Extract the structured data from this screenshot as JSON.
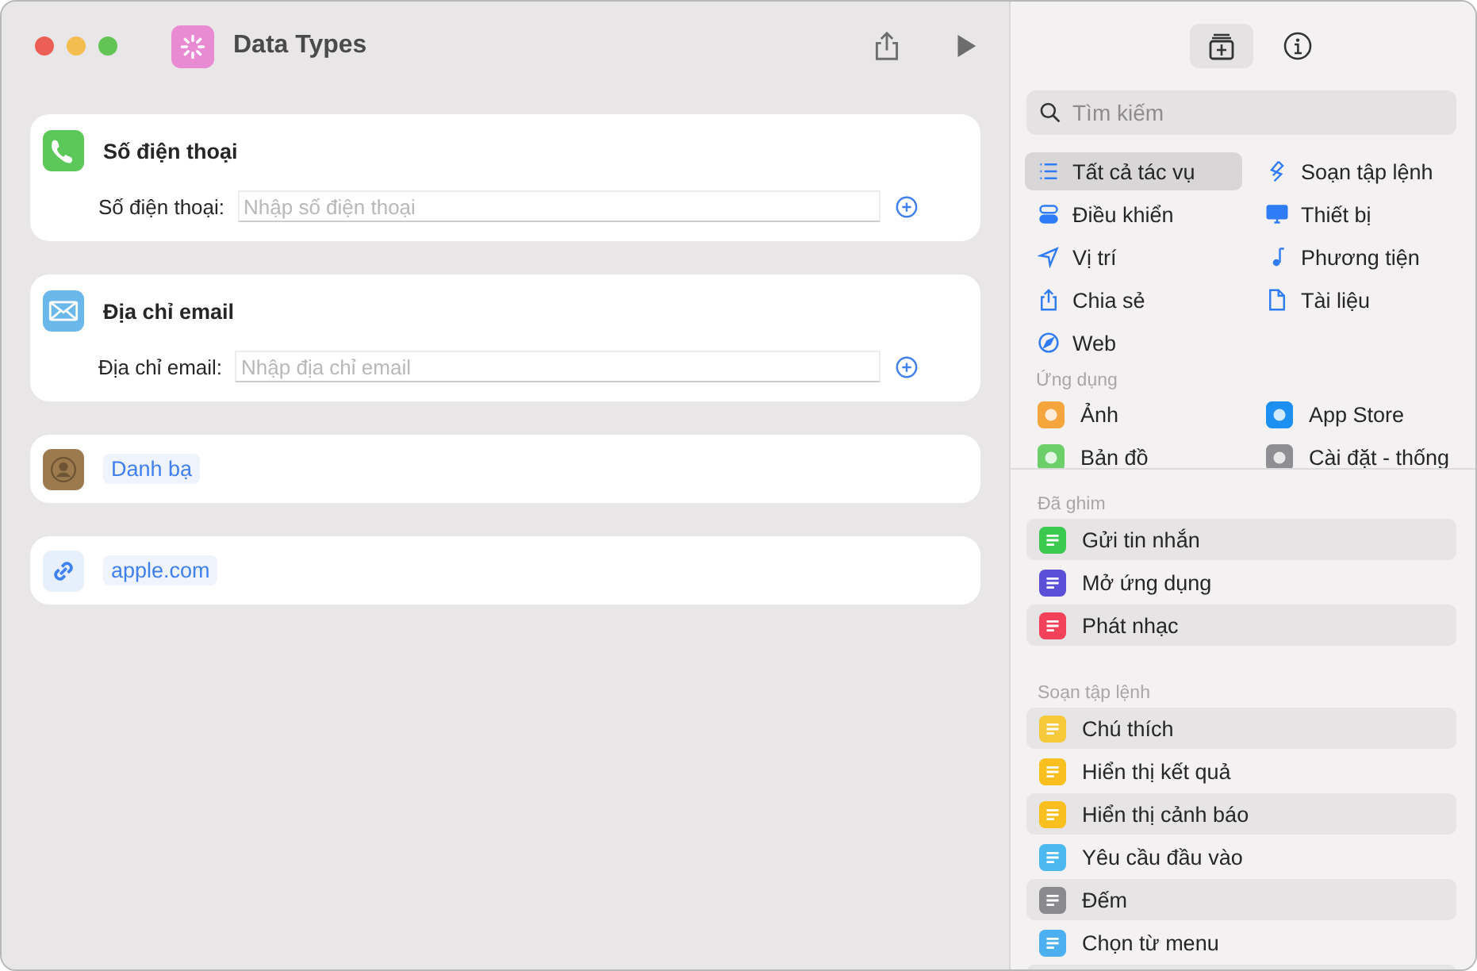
{
  "window": {
    "title": "Data Types"
  },
  "cards": [
    {
      "kind": "field",
      "title": "Số điện thoại",
      "label": "Số điện thoại:",
      "placeholder": "Nhập số điện thoại",
      "color": "#5dc85a"
    },
    {
      "kind": "field",
      "title": "Địa chỉ email",
      "label": "Địa chỉ email:",
      "placeholder": "Nhập địa chỉ email",
      "color": "#6ab8ea"
    },
    {
      "kind": "token",
      "token": "Danh bạ",
      "color": "#9c7a4e"
    },
    {
      "kind": "token",
      "token": "apple.com",
      "color": "#e6effc"
    }
  ],
  "search": {
    "placeholder": "Tìm kiếm"
  },
  "categories": [
    {
      "label": "Tất cả tác vụ",
      "selected": true
    },
    {
      "label": "Soạn tập lệnh",
      "selected": false
    },
    {
      "label": "Điều khiển",
      "selected": false
    },
    {
      "label": "Thiết bị",
      "selected": false
    },
    {
      "label": "Vị trí",
      "selected": false
    },
    {
      "label": "Phương tiện",
      "selected": false
    },
    {
      "label": "Chia sẻ",
      "selected": false
    },
    {
      "label": "Tài liệu",
      "selected": false
    },
    {
      "label": "Web",
      "selected": false
    }
  ],
  "apps": {
    "heading": "Ứng dụng",
    "items": [
      {
        "label": "Ảnh",
        "color": "#f4a53c"
      },
      {
        "label": "App Store",
        "color": "#1d8ff0"
      },
      {
        "label": "Bản đồ",
        "color": "#6ccf6a"
      },
      {
        "label": "Cài đặt - thống",
        "color": "#8e8e93"
      }
    ]
  },
  "sections": [
    {
      "heading": "Đã ghim",
      "items": [
        {
          "label": "Gửi tin nhắn",
          "color": "#3cc94f"
        },
        {
          "label": "Mở ứng dụng",
          "color": "#5b4fd8"
        },
        {
          "label": "Phát nhạc",
          "color": "#f2425a"
        }
      ]
    },
    {
      "heading": "Soạn tập lệnh",
      "items": [
        {
          "label": "Chú thích",
          "color": "#f5c93a"
        },
        {
          "label": "Hiển thị kết quả",
          "color": "#f9bf1e"
        },
        {
          "label": "Hiển thị cảnh báo",
          "color": "#f9bf1e"
        },
        {
          "label": "Yêu cầu đầu vào",
          "color": "#4cb8f0"
        },
        {
          "label": "Đếm",
          "color": "#8a8a8e"
        },
        {
          "label": "Chọn từ menu",
          "color": "#4cb0f0"
        }
      ]
    }
  ]
}
